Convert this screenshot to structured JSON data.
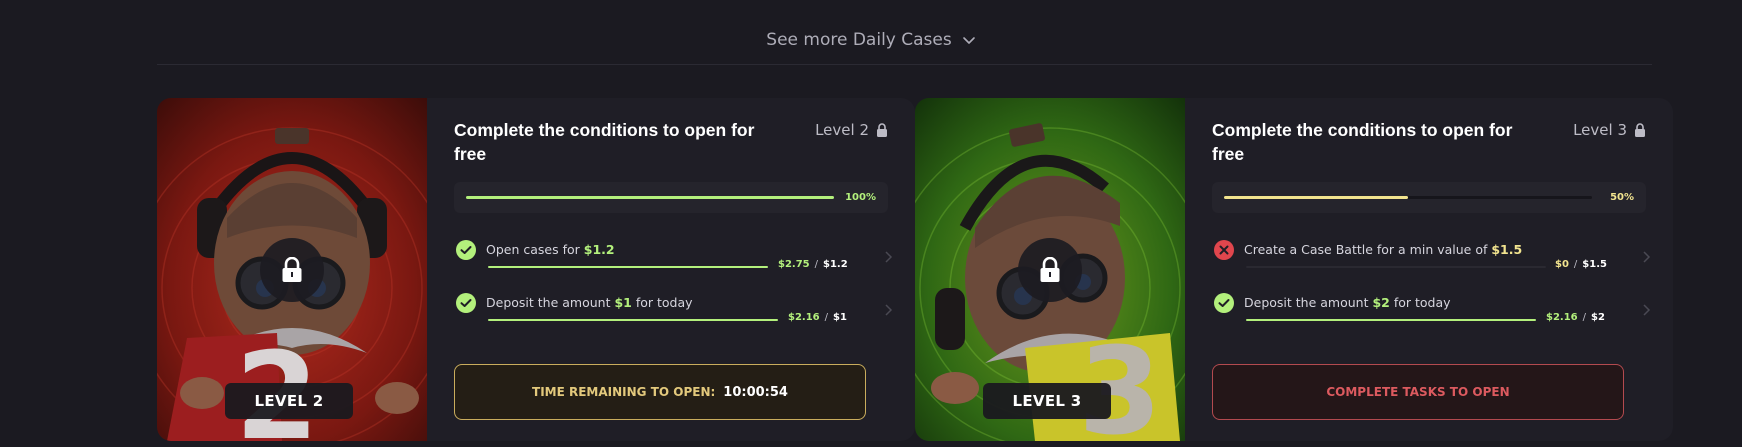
{
  "see_more": {
    "label": "See more Daily Cases",
    "icon": "chevron-down-icon"
  },
  "cards": [
    {
      "title": "Complete the conditions to open for free",
      "level_label": "Level 2",
      "badge": "LEVEL 2",
      "art_number": "2",
      "progress": {
        "percent_label": "100%",
        "value": 1.0,
        "color": "#b3f07c"
      },
      "tasks": [
        {
          "status": "done",
          "text_pre": "Open cases for ",
          "highlight": "$1.2",
          "text_post": "",
          "current": "$2.75",
          "separator": "/",
          "target": "$1.2",
          "progress": 1.0
        },
        {
          "status": "done",
          "text_pre": "Deposit the amount ",
          "highlight": "$1",
          "text_post": " for today",
          "current": "$2.16",
          "separator": "/",
          "target": "$1",
          "progress": 1.0
        }
      ],
      "action": {
        "type": "timer",
        "label": "TIME REMAINING TO OPEN:",
        "time": "10:00:54"
      }
    },
    {
      "title": "Complete the conditions to open for free",
      "level_label": "Level 3",
      "badge": "LEVEL 3",
      "art_number": "3",
      "progress": {
        "percent_label": "50%",
        "value": 0.5,
        "color": "#f2e48f"
      },
      "tasks": [
        {
          "status": "failed",
          "text_pre": "Create a Case Battle for a min value of ",
          "highlight": "$1.5",
          "text_post": "",
          "current": "$0",
          "separator": "/",
          "target": "$1.5",
          "progress": 0.0
        },
        {
          "status": "done",
          "text_pre": "Deposit the amount ",
          "highlight": "$2",
          "text_post": " for today",
          "current": "$2.16",
          "separator": "/",
          "target": "$2",
          "progress": 1.0
        }
      ],
      "action": {
        "type": "complete",
        "label": "COMPLETE TASKS TO OPEN"
      }
    }
  ],
  "colors": {
    "green": "#b3f07c",
    "yellow": "#f2e48f",
    "red": "#dc5a5f",
    "gold": "#e3c97c"
  }
}
